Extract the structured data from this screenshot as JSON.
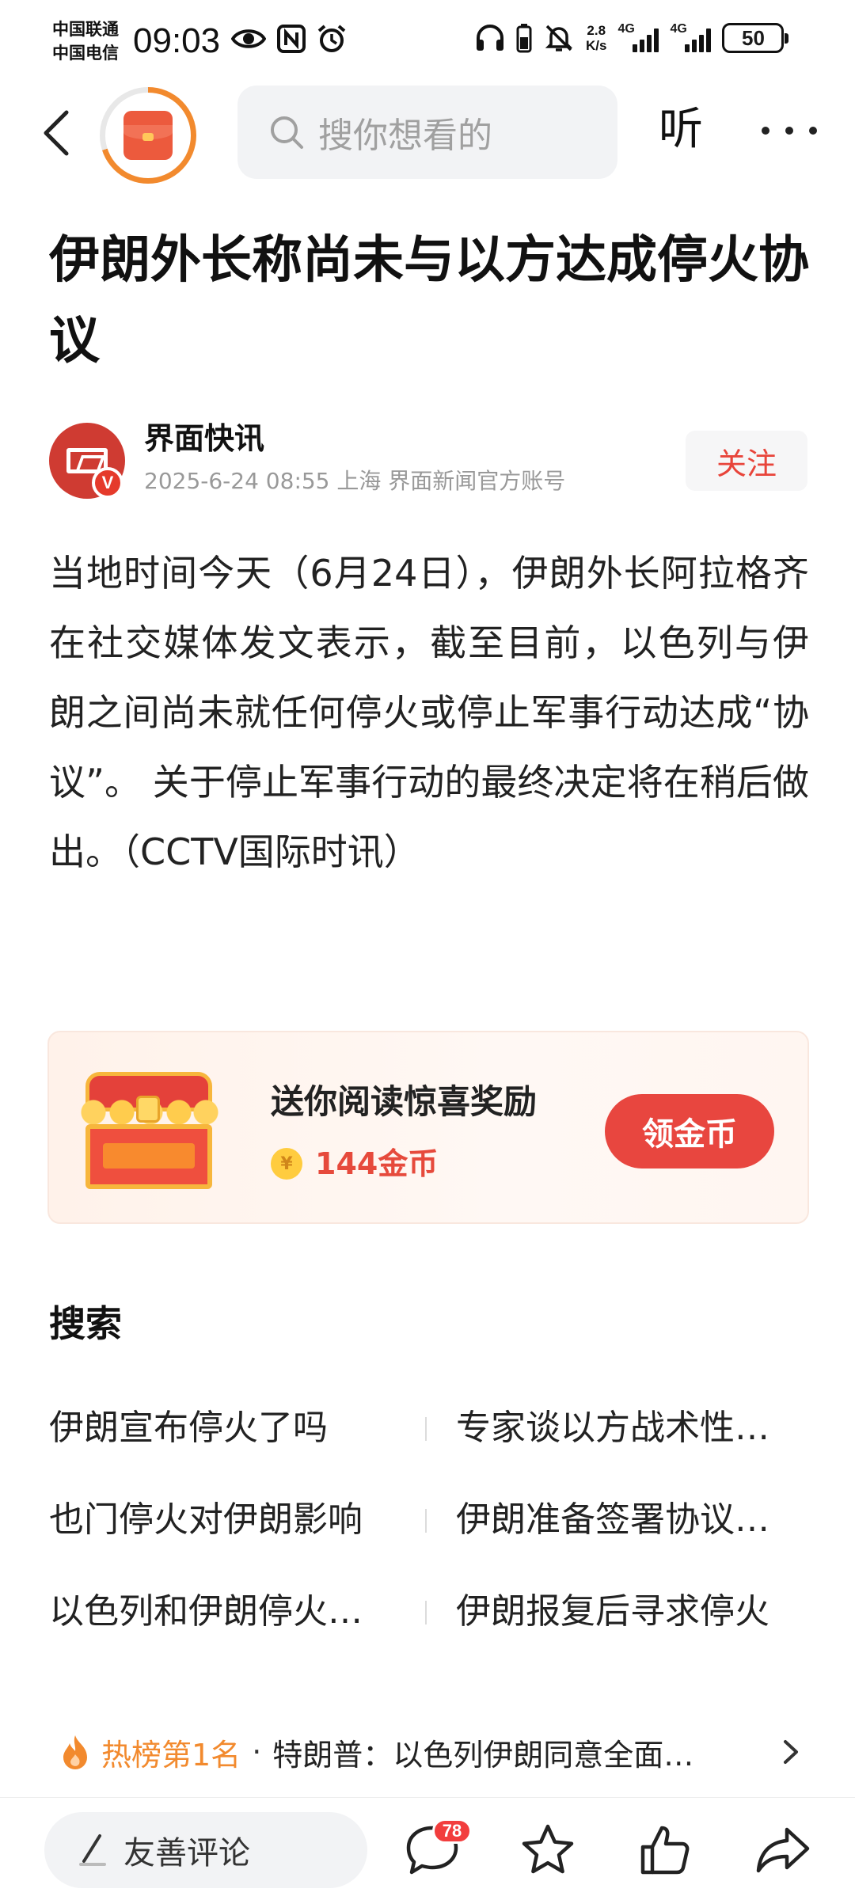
{
  "status_bar": {
    "carrier_1": "中国联通",
    "carrier_2": "中国电信",
    "time": "09:03",
    "net_speed_value": "2.8",
    "net_speed_unit": "K/s",
    "signal_1_label": "4G",
    "signal_2_label": "4G",
    "battery": "50",
    "icons": [
      "eye-icon",
      "nfc-icon",
      "alarm-icon",
      "headphones-icon",
      "battery-small-icon",
      "mute-icon"
    ]
  },
  "top_bar": {
    "search_placeholder": "搜你想看的",
    "listen_label": "听"
  },
  "article": {
    "title": "伊朗外长称尚未与以方达成停火协议",
    "author_name": "界面快讯",
    "author_meta": "2025-6-24  08:55  上海  界面新闻官方账号",
    "verified_badge": "V",
    "follow_label": "关注",
    "body": "当地时间今天（6月24日），伊朗外长阿拉格齐在社交媒体发文表示，截至目前，以色列与伊朗之间尚未就任何停火或停止军事行动达成“协议”。 关于停止军事行动的最终决定将在稍后做出。（CCTV国际时讯）"
  },
  "reward_card": {
    "title": "送你阅读惊喜奖励",
    "coin_symbol": "¥",
    "coins": "144金币",
    "button_label": "领金币"
  },
  "search_section": {
    "heading": "搜索",
    "suggestions": [
      "伊朗宣布停火了吗",
      "专家谈以方战术性…",
      "也门停火对伊朗影响",
      "伊朗准备签署协议…",
      "以色列和伊朗停火…",
      "伊朗报复后寻求停火"
    ]
  },
  "hot_list": {
    "rank_label": "热榜第1名",
    "separator": "·",
    "headline": "特朗普：以色列伊朗同意全面…"
  },
  "bottom_bar": {
    "comment_placeholder": "友善评论",
    "comment_count": "78"
  },
  "colors": {
    "accent_red": "#e8463f",
    "hot_orange": "#f28a2e",
    "follow_text": "#e8443a"
  }
}
